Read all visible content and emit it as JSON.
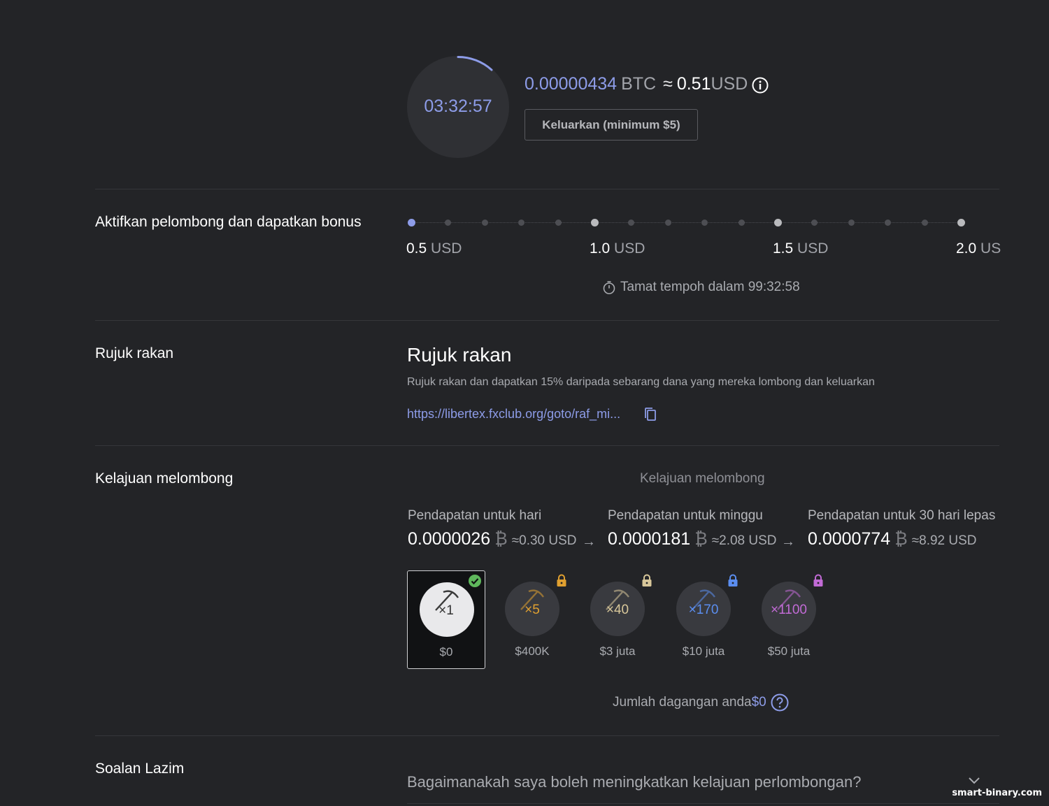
{
  "timer": {
    "value": "03:32:57",
    "progress": 0.1
  },
  "balance": {
    "btc_amount": "0.00000434",
    "btc_unit": "BTC",
    "approx": "≈",
    "usd_amount": "0.51",
    "usd_unit": "USD",
    "info_icon": "info-icon"
  },
  "withdraw_button": {
    "label": "Keluarkan (minimum $5)"
  },
  "bonus": {
    "title": "Aktifkan pelombong dan dapatkan bonus",
    "milestones": [
      {
        "value": "0.5",
        "unit": "USD"
      },
      {
        "value": "1.0",
        "unit": "USD"
      },
      {
        "value": "1.5",
        "unit": "USD"
      },
      {
        "value": "2.0",
        "unit": "US"
      }
    ],
    "progress_steps": 16,
    "active_step": 0,
    "expiry_icon": "stopwatch-icon",
    "expiry_text": "Tamat tempoh dalam 99:32:58"
  },
  "referral": {
    "section_title": "Rujuk rakan",
    "heading": "Rujuk rakan",
    "description": "Rujuk rakan dan dapatkan 15% daripada sebarang dana yang mereka lombong dan keluarkan",
    "link": "https://libertex.fxclub.org/goto/raf_mi...",
    "copy_icon": "copy-icon"
  },
  "speed": {
    "section_title": "Kelajuan melombong",
    "caption": "Kelajuan melombong",
    "earnings": [
      {
        "label": "Pendapatan untuk hari",
        "value": "0.0000026",
        "btc_symbol": "₿",
        "usd": "≈0.30 USD"
      },
      {
        "label": "Pendapatan untuk minggu",
        "value": "0.0000181",
        "btc_symbol": "₿",
        "usd": "≈2.08 USD"
      },
      {
        "label": "Pendapatan untuk 30 hari lepas",
        "value": "0.0000774",
        "btc_symbol": "₿",
        "usd": "≈8.92 USD"
      }
    ],
    "arrow": "→",
    "levels": [
      {
        "mult": "×1",
        "price": "$0",
        "color": "#555555",
        "status": "active"
      },
      {
        "mult": "×5",
        "price": "$400K",
        "color": "#e0a030",
        "status": "locked"
      },
      {
        "mult": "×40",
        "price": "$3 juta",
        "color": "#d8c79a",
        "status": "locked"
      },
      {
        "mult": "×170",
        "price": "$10 juta",
        "color": "#5b8ef0",
        "status": "locked"
      },
      {
        "mult": "×1100",
        "price": "$50 juta",
        "color": "#c26bd6",
        "status": "locked"
      }
    ],
    "trade_volume_label": "Jumlah dagangan anda",
    "trade_volume_amount": "$0"
  },
  "faq": {
    "section_title": "Soalan Lazim",
    "question": "Bagaimanakah saya boleh meningkatkan kelajuan perlombongan?"
  },
  "watermark": "smart-binary.com"
}
